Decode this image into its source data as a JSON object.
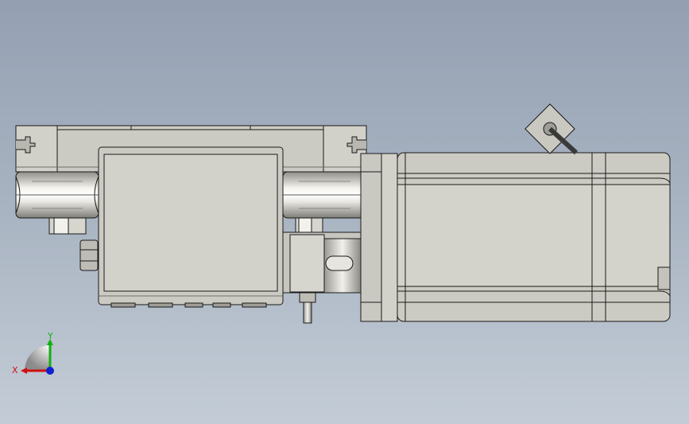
{
  "viewport": {
    "background_top": "#94a0b2",
    "background_bottom": "#c3ccd6"
  },
  "model": {
    "body_color": "#cccbc3",
    "body_color_light": "#dddcd4",
    "edge_color": "#1a1a1a",
    "shadow_color": "#6e6d68"
  },
  "triad": {
    "x_label": "X",
    "y_label": "Y",
    "x_color": "#d01010",
    "y_color": "#10b010",
    "z_color": "#1020d0"
  }
}
